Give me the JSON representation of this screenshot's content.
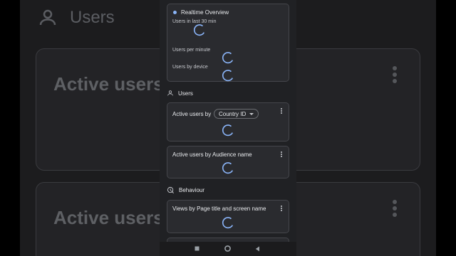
{
  "background": {
    "title": "Users",
    "cards": [
      {
        "title": "Active users"
      },
      {
        "title": "Active users"
      }
    ]
  },
  "realtime": {
    "title": "Realtime Overview",
    "metric_1": "Users in last 30 min",
    "metric_2": "Users per minute",
    "metric_3": "Users by device"
  },
  "users_section": {
    "title": "Users"
  },
  "active_by_country": {
    "label": "Active users by",
    "dropdown_value": "Country ID"
  },
  "active_by_audience": {
    "label": "Active users by Audience name"
  },
  "behaviour_section": {
    "title": "Behaviour"
  },
  "views_by_page": {
    "label": "Views by Page title and screen name"
  },
  "colors": {
    "accent": "#8ab4f8",
    "card_bg": "#2a2b2f",
    "screen_bg": "#202124"
  }
}
